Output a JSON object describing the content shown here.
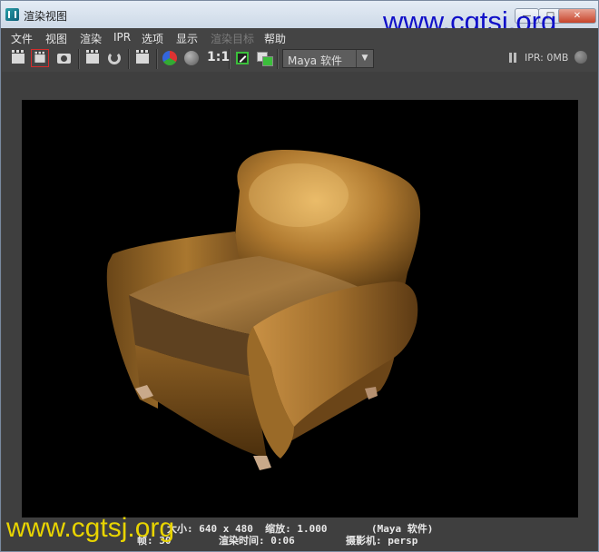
{
  "window": {
    "title": "渲染视图",
    "controls": {
      "minimize": "—",
      "maximize": "□",
      "close": "✕"
    }
  },
  "watermarks": {
    "top": "www.cgtsj.org",
    "bottom": "www.cgtsj.org"
  },
  "menu": {
    "items": [
      {
        "label": "文件",
        "enabled": true
      },
      {
        "label": "视图",
        "enabled": true
      },
      {
        "label": "渲染",
        "enabled": true
      },
      {
        "label": "IPR",
        "enabled": true
      },
      {
        "label": "选项",
        "enabled": true
      },
      {
        "label": "显示",
        "enabled": true
      },
      {
        "label": "渲染目标",
        "enabled": false
      },
      {
        "label": "帮助",
        "enabled": true
      }
    ]
  },
  "toolbar": {
    "ratio_label": "1:1",
    "renderer_value": "Maya 软件",
    "ipr_status": "IPR: 0MB",
    "icons": [
      "render-frame-icon",
      "render-region-icon",
      "snapshot-icon",
      "ipr-render-icon",
      "refresh-icon",
      "render-sequence-icon",
      "rgb-channels-icon",
      "alpha-channel-icon",
      "test-resolution-icon",
      "keep-image-icon",
      "pause-icon",
      "ipr-indicator-icon"
    ]
  },
  "render_info": {
    "size_line": "大小: 640 x 480  缩放: 1.000",
    "renderer_line": "(Maya 软件)",
    "frame_line": "帧: 30",
    "time_line": "渲染时间: 0:06",
    "camera_line": "摄影机: persp"
  },
  "colors": {
    "window_bg": "#444444",
    "titlebar": "#dbe4ef",
    "watermark_top": "#1010c8",
    "watermark_bottom": "#e8d400",
    "chair_leather": "#a0702a"
  }
}
